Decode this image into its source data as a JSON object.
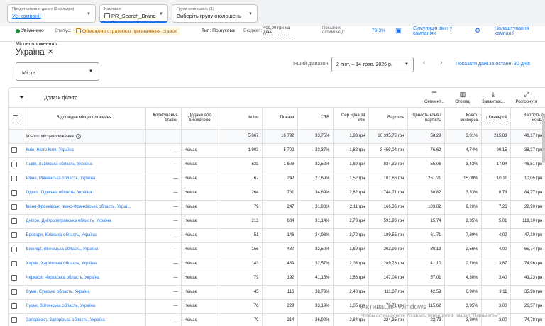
{
  "header": {
    "views": {
      "label": "Представлення даних (2 фільтри)",
      "value": "Усі кампанії"
    },
    "campaign": {
      "label": "Кампанія",
      "value": "PR_Search_Brand"
    },
    "adgroup": {
      "label": "Групи оголошень (1)",
      "value": "Виберіть групу оголошень"
    }
  },
  "status": {
    "state": "Увімкнено",
    "status_label": "Статус:",
    "status_value": "Обмежено стратегією призначення ставок",
    "type": "Тип: Пошукова",
    "budget_label": "Бюджет:",
    "budget_value": "400,00 грн на день",
    "optscore_label": "Показник оптимізації:",
    "optscore_value": "79,3%",
    "simulate": "Симуляція змін у кампаніях",
    "settings": "Налаштування кампанії"
  },
  "page": {
    "breadcrumb": "Місцеположення",
    "title": "Україна",
    "location_filter": "Міста",
    "range_label": "Інший діапазон",
    "range_value": "2 лют. – 14 трав. 2026 р.",
    "show_last": "Показати дані за останні 30 днів"
  },
  "toolbar": {
    "add_filter": "Додати фільтр",
    "segment": "Сегмент...",
    "columns": "Стовпці",
    "download": "Завантаж...",
    "expand": "Розгорнути"
  },
  "table": {
    "headers": [
      "Відповідне місцеположення",
      "Коригування ставки",
      "Додано або виключено",
      "Кліки",
      "Покази",
      "CTR",
      "Сер. ціна за клік",
      "Вартість",
      "Цінність конв./вартість",
      "Коеф. конверсії",
      "Конверсії",
      "Вартість / конв."
    ],
    "total": {
      "label": "Усього: місцеположення",
      "values": [
        "5 667",
        "16 792",
        "33,75%",
        "1,83 грн",
        "10 395,75 грн",
        "58,29",
        "3,81%",
        "215,83",
        "48,17 грн"
      ]
    },
    "rows": [
      {
        "loc": "Київ, місто Київ, Україна",
        "adj": "—",
        "added": "Немає",
        "v": [
          "1 903",
          "5 702",
          "33,37%",
          "1,82 грн",
          "3 459,04 грн",
          "76,62",
          "4,74%",
          "90,15",
          "38,37 грн"
        ]
      },
      {
        "loc": "Львів, Львівська область, Україна",
        "adj": "—",
        "added": "Немає",
        "v": [
          "523",
          "1 608",
          "32,52%",
          "1,60 грн",
          "834,32 грн",
          "55,06",
          "3,43%",
          "17,94",
          "46,51 грн"
        ]
      },
      {
        "loc": "Рівне, Рівненська область, Україна",
        "adj": "—",
        "added": "Немає",
        "v": [
          "67",
          "242",
          "27,69%",
          "1,52 грн",
          "101,66 грн",
          "251,21",
          "15,09%",
          "10,11",
          "10,05 грн"
        ]
      },
      {
        "loc": "Одеса, Одеська область, Україна",
        "adj": "—",
        "added": "Немає",
        "v": [
          "264",
          "761",
          "34,69%",
          "2,82 грн",
          "744,71 грн",
          "30,82",
          "3,33%",
          "8,78",
          "84,77 грн"
        ]
      },
      {
        "loc": "Івано-Франківськ, Івано-Франківська область, Украї...",
        "adj": "—",
        "added": "Немає",
        "v": [
          "79",
          "247",
          "31,98%",
          "2,11 грн",
          "166,36 грн",
          "103,82",
          "9,20%",
          "7,26",
          "22,90 грн"
        ]
      },
      {
        "loc": "Дніпро, Дніпропетровська область, Україна",
        "adj": "—",
        "added": "Немає",
        "v": [
          "213",
          "684",
          "31,14%",
          "2,78 грн",
          "591,96 грн",
          "15,74",
          "2,35%",
          "5,01",
          "118,10 грн"
        ]
      },
      {
        "loc": "Бровари, Київська область, Україна",
        "adj": "—",
        "added": "Немає",
        "v": [
          "51",
          "146",
          "34,93%",
          "3,72 грн",
          "189,55 грн",
          "61,71",
          "7,89%",
          "4,02",
          "47,10 грн"
        ]
      },
      {
        "loc": "Вінниця, Вінницька область, Україна",
        "adj": "—",
        "added": "Немає",
        "v": [
          "156",
          "480",
          "32,50%",
          "1,69 грн",
          "262,96 грн",
          "86,13",
          "2,56%",
          "4,00",
          "65,74 грн"
        ]
      },
      {
        "loc": "Харків, Харківська область, Україна",
        "adj": "—",
        "added": "Немає",
        "v": [
          "143",
          "439",
          "32,57%",
          "2,03 грн",
          "289,73 грн",
          "41,10",
          "2,70%",
          "3,87",
          "74,96 грн"
        ]
      },
      {
        "loc": "Черкаси, Черкаська область, Україна",
        "adj": "—",
        "added": "Немає",
        "v": [
          "79",
          "192",
          "41,15%",
          "1,86 грн",
          "147,04 грн",
          "57,01",
          "4,30%",
          "3,40",
          "43,23 грн"
        ]
      },
      {
        "loc": "Суми, Сумська область, Україна",
        "adj": "—",
        "added": "Немає",
        "v": [
          "45",
          "116",
          "38,79%",
          "2,48 грн",
          "111,67 грн",
          "42,59",
          "6,90%",
          "3,11",
          "35,96 грн"
        ]
      },
      {
        "loc": "Луцьк, Волинська область, Україна",
        "adj": "—",
        "added": "Немає",
        "v": [
          "76",
          "229",
          "33,19%",
          "1,05 грн",
          "79,71 грн",
          "115,62",
          "3,95%",
          "3,00",
          "26,57 грн"
        ]
      },
      {
        "loc": "Запоріжжя, Запорізька область, Україна",
        "adj": "—",
        "added": "Немає",
        "v": [
          "79",
          "214",
          "36,92%",
          "2,84 грн",
          "224,35 грн",
          "22,73",
          "3,80%",
          "3,00",
          "74,78 грн"
        ]
      }
    ]
  },
  "watermark": {
    "title": "Активация Windows",
    "subtitle": "Чтобы активировать Windows, перейдите в раздел \"Параметры\"."
  }
}
